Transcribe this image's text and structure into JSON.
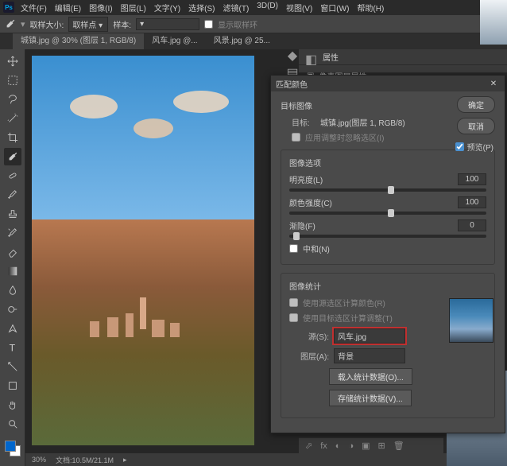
{
  "menu": [
    "文件(F)",
    "编辑(E)",
    "图像(I)",
    "图层(L)",
    "文字(Y)",
    "选择(S)",
    "滤镜(T)",
    "3D(D)",
    "视图(V)",
    "窗口(W)",
    "帮助(H)"
  ],
  "optbar": {
    "sample_label": "取样大小:",
    "sample_value": "取样点",
    "field_label": "样本:",
    "placeholder": "显示取样环"
  },
  "tabs": [
    "城镇.jpg @ 30% (图层 1, RGB/8)",
    "风车.jpg @...",
    "风景.jpg @ 25..."
  ],
  "properties": {
    "title": "属性",
    "desc": "像素图层属性"
  },
  "dialog": {
    "title": "匹配颜色",
    "ok": "确定",
    "cancel": "取消",
    "preview": "预览(P)",
    "target_section": "目标图像",
    "target_label": "目标:",
    "target_value": "城镇.jpg(图层 1, RGB/8)",
    "target_cb": "应用调整时忽略选区(I)",
    "options_group": "图像选项",
    "brightness": "明亮度(L)",
    "brightness_val": "100",
    "color": "颜色强度(C)",
    "color_val": "100",
    "fade": "渐隐(F)",
    "fade_val": "0",
    "neutralize": "中和(N)",
    "stats_group": "图像统计",
    "stats_cb1": "使用源选区计算颜色(R)",
    "stats_cb2": "使用目标选区计算调整(T)",
    "source_label": "源(S):",
    "source_value": "风车.jpg",
    "layer_label": "图层(A):",
    "layer_value": "背景",
    "load_btn": "载入统计数据(O)...",
    "save_btn": "存储统计数据(V)..."
  },
  "status": {
    "zoom": "30%",
    "doc": "文档:10.5M/21.1M"
  }
}
